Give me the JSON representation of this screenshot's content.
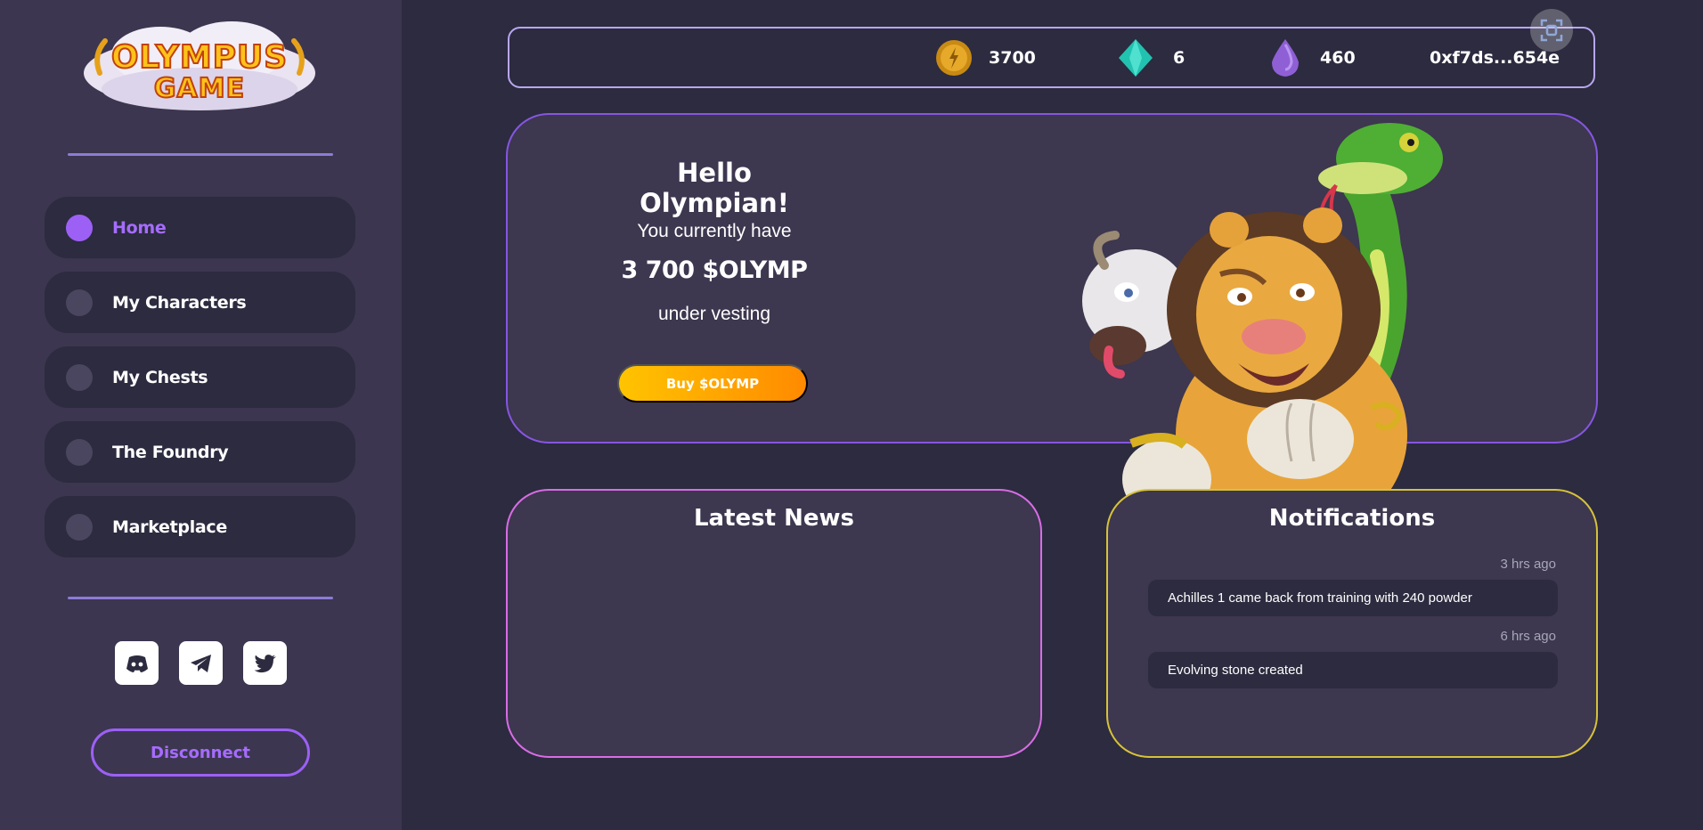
{
  "brand": {
    "logo_line1": "OLYMPUS",
    "logo_line2": "GAME"
  },
  "sidebar": {
    "items": [
      {
        "label": "Home",
        "active": true
      },
      {
        "label": "My Characters",
        "active": false
      },
      {
        "label": "My Chests",
        "active": false
      },
      {
        "label": "The Foundry",
        "active": false
      },
      {
        "label": "Marketplace",
        "active": false
      }
    ],
    "socials": [
      "discord-icon",
      "telegram-icon",
      "twitter-icon"
    ],
    "disconnect_label": "Disconnect"
  },
  "topbar": {
    "coins": "3700",
    "gems": "6",
    "crystals": "460",
    "wallet": "0xf7ds...654e",
    "icons": [
      "coin-icon",
      "gem-icon",
      "crystal-icon",
      "scan-icon"
    ]
  },
  "hero": {
    "title": "Hello Olympian!",
    "line1": "You currently have",
    "amount": "3 700 $OLYMP",
    "line2": "under vesting",
    "buy_label": "Buy $OLYMP"
  },
  "news": {
    "title": "Latest News"
  },
  "notifications": {
    "title": "Notifications",
    "items": [
      {
        "time": "3 hrs ago",
        "text": "Achilles 1 came back from training with 240 powder"
      },
      {
        "time": "6 hrs ago",
        "text": "Evolving stone created"
      }
    ]
  },
  "colors": {
    "background": "#2c2b3f",
    "sidebar": "#3c3650",
    "accent": "#9c60f5",
    "buy_gradient_start": "#ffc400",
    "buy_gradient_end": "#ff8a00",
    "news_border": "#d86ce6",
    "notif_border": "#d6c23a"
  }
}
